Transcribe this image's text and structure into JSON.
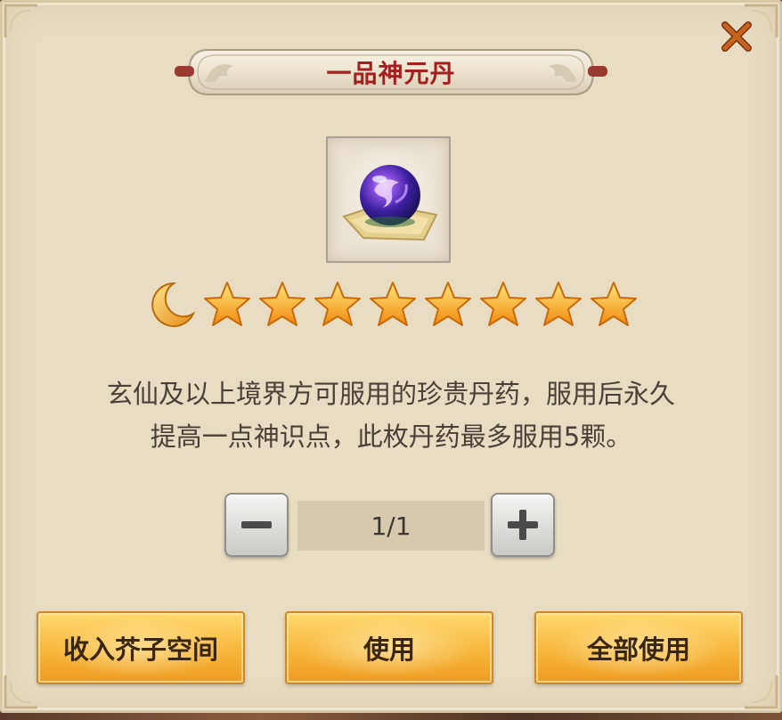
{
  "dialog": {
    "title": "一品神元丹",
    "close_icon": "close-x-icon",
    "item_icon": "purple-elixir-orb-icon",
    "rating": {
      "moons": 1,
      "stars": 8,
      "moon_icon": "crescent-moon-icon",
      "star_icon": "gold-star-icon"
    },
    "description_line1": "玄仙及以上境界方可服用的珍贵丹药，服用后永久",
    "description_line2": "提高一点神识点，此枚丹药最多服用5颗。",
    "quantity": {
      "value": "1/1",
      "minus_icon": "minus-icon",
      "plus_icon": "plus-icon"
    },
    "buttons": {
      "store_label": "收入芥子空间",
      "use_label": "使用",
      "use_all_label": "全部使用"
    }
  },
  "colors": {
    "panel_bg": "#e8dcc2",
    "title_red": "#a61f1f",
    "button_gold": "#f7b63a",
    "close_orange": "#b8551a",
    "text_dark": "#4a4038"
  }
}
